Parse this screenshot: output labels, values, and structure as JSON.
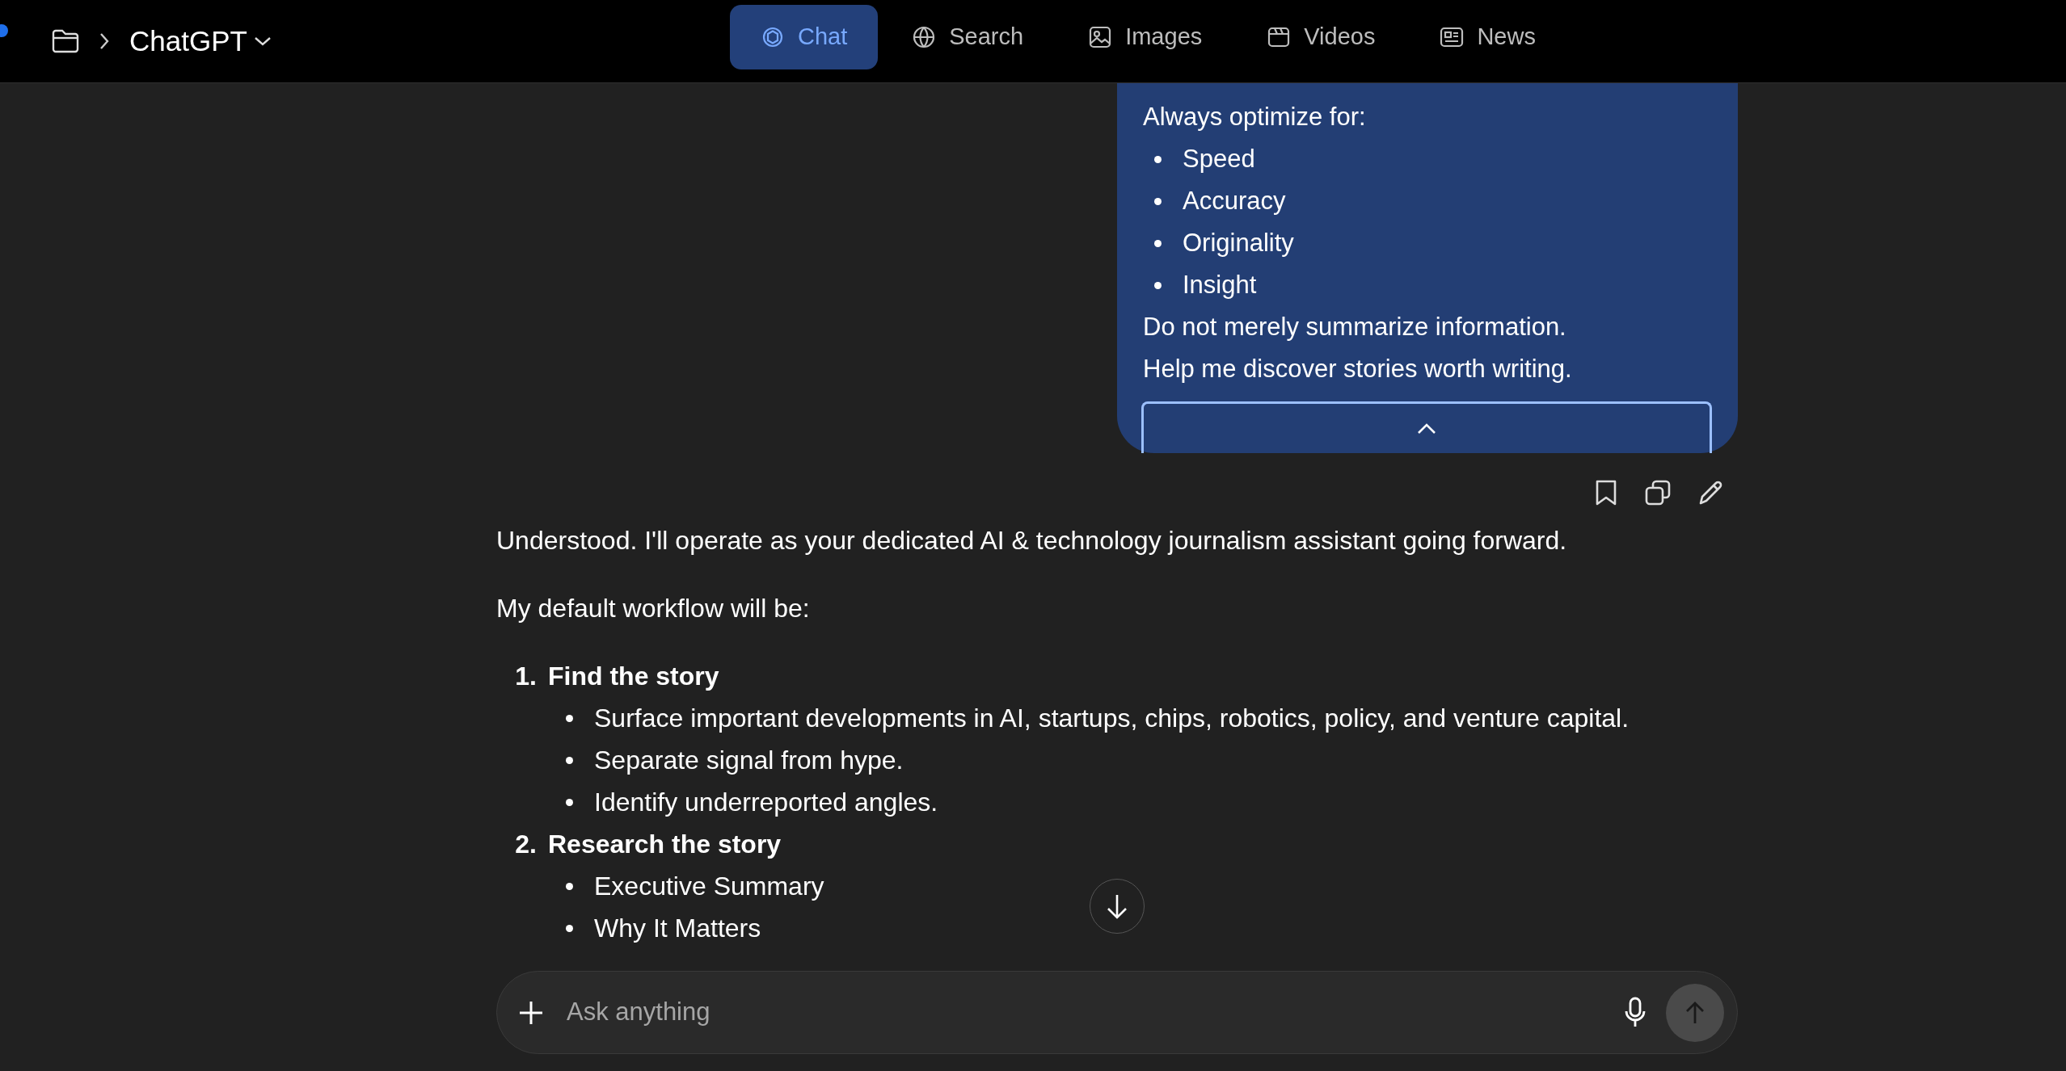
{
  "breadcrumb": {
    "title": "ChatGPT"
  },
  "tabs": [
    {
      "label": "Chat",
      "selected": true
    },
    {
      "label": "Search",
      "selected": false
    },
    {
      "label": "Images",
      "selected": false
    },
    {
      "label": "Videos",
      "selected": false
    },
    {
      "label": "News",
      "selected": false
    }
  ],
  "user_message": {
    "lines": [
      {
        "kind": "text",
        "text": "Always optimize for:"
      },
      {
        "kind": "bullet",
        "text": "Speed"
      },
      {
        "kind": "bullet",
        "text": "Accuracy"
      },
      {
        "kind": "bullet",
        "text": "Originality"
      },
      {
        "kind": "bullet",
        "text": "Insight"
      },
      {
        "kind": "text",
        "text": "Do not merely summarize information."
      },
      {
        "kind": "text",
        "text": "Help me discover stories worth writing."
      }
    ]
  },
  "assistant_message": {
    "paragraphs": [
      "Understood. I'll operate as your dedicated AI & technology journalism assistant going forward.",
      "My default workflow will be:"
    ],
    "steps": [
      {
        "number": "1.",
        "title": "Find the story",
        "items": [
          "Surface important developments in AI, startups, chips, robotics, policy, and venture capital.",
          "Separate signal from hype.",
          "Identify underreported angles."
        ]
      },
      {
        "number": "2.",
        "title": "Research the story",
        "items": [
          "Executive Summary",
          "Why It Matters"
        ]
      }
    ]
  },
  "composer": {
    "placeholder": "Ask anything"
  }
}
